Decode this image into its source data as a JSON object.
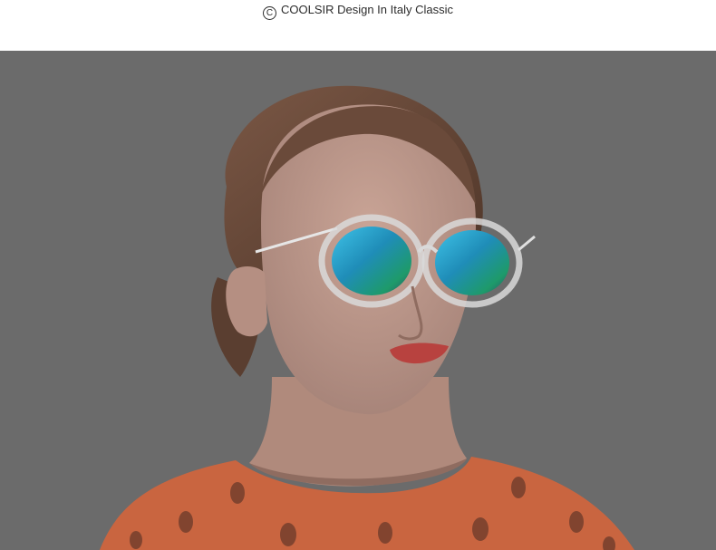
{
  "header": {
    "copyright_symbol": "C",
    "caption": "COOLSIR Design In Italy Classic"
  },
  "photo": {
    "subject": "model-wearing-mirrored-sunglasses",
    "colors": {
      "background": "#6b6b6b",
      "lens": "#2b8fb8",
      "shirt": "#d86a43",
      "hair": "#6a4a3a"
    }
  }
}
